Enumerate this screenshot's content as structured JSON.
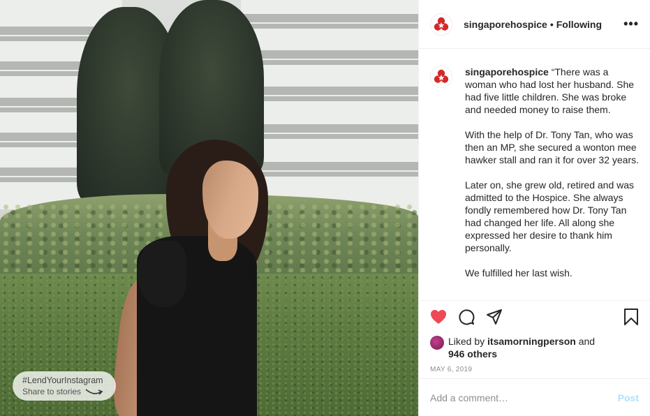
{
  "photo": {
    "hashtag": "#LendYourInstagram",
    "share_label": "Share to stories"
  },
  "header": {
    "username": "singaporehospice",
    "separator": "•",
    "follow_status": "Following",
    "more_icon": "more-options-icon"
  },
  "caption": {
    "username": "singaporehospice",
    "paragraphs": [
      "“There was a woman who had lost her husband. She had five little children. She was broke and needed money to raise them.",
      "With the help of Dr. Tony Tan, who was then an MP, she secured a wonton mee hawker stall and ran it for over 32 years.",
      "Later on, she grew old, retired and was admitted to the Hospice. She always fondly remembered how Dr. Tony Tan had changed her life. All along she expressed her desire to thank him personally.",
      "We fulfilled her last wish."
    ]
  },
  "actions": {
    "like_icon": "heart-filled-icon",
    "comment_icon": "comment-icon",
    "share_icon": "paper-plane-icon",
    "save_icon": "bookmark-icon",
    "like_color": "#ed4956"
  },
  "likes": {
    "prefix": "Liked by",
    "user": "itsamorningperson",
    "conjunction": "and",
    "others": "946 others"
  },
  "date": "MAY 6, 2019",
  "comment": {
    "placeholder": "Add a comment…",
    "post_label": "Post"
  },
  "colors": {
    "brand_red": "#d62828",
    "post_disabled": "#b2dffc"
  }
}
